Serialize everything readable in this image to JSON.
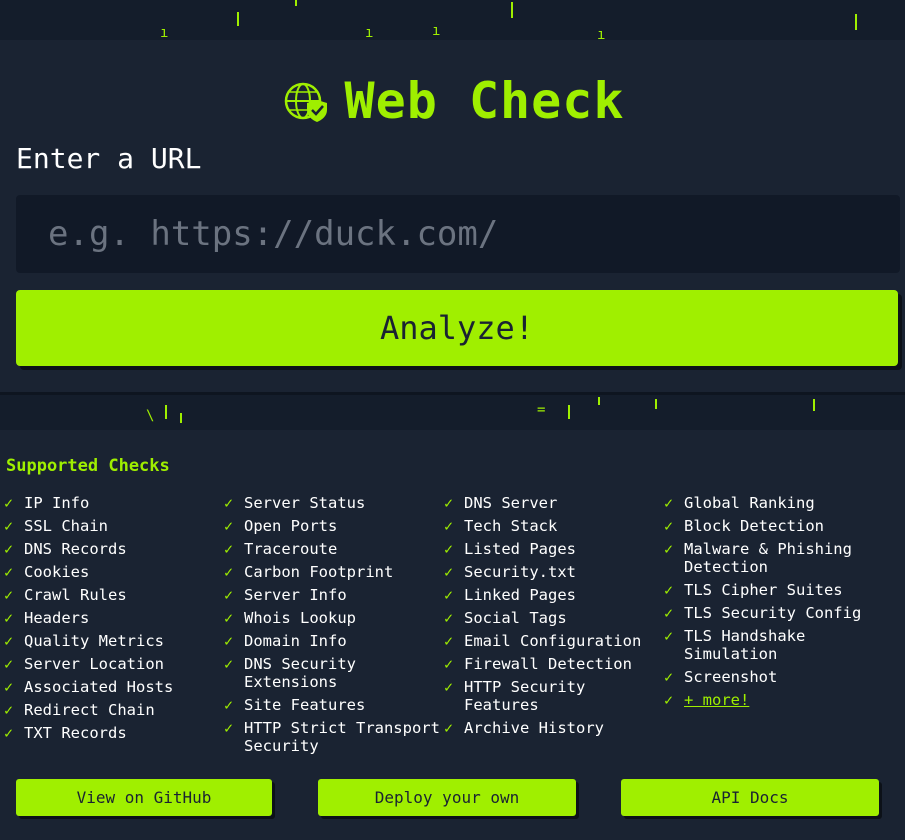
{
  "app": {
    "title": "Web Check",
    "url_label": "Enter a URL",
    "url_placeholder": "e.g. https://duck.com/",
    "url_value": "",
    "analyze_label": "Analyze!"
  },
  "checks": {
    "heading": "Supported Checks",
    "columns": [
      [
        "IP Info",
        "SSL Chain",
        "DNS Records",
        "Cookies",
        "Crawl Rules",
        "Headers",
        "Quality Metrics",
        "Server Location",
        "Associated Hosts",
        "Redirect Chain",
        "TXT Records"
      ],
      [
        "Server Status",
        "Open Ports",
        "Traceroute",
        "Carbon Footprint",
        "Server Info",
        "Whois Lookup",
        "Domain Info",
        "DNS Security Extensions",
        "Site Features",
        "HTTP Strict Transport Security"
      ],
      [
        "DNS Server",
        "Tech Stack",
        "Listed Pages",
        "Security.txt",
        "Linked Pages",
        "Social Tags",
        "Email Configuration",
        "Firewall Detection",
        "HTTP Security Features",
        "Archive History"
      ],
      [
        "Global Ranking",
        "Block Detection",
        "Malware & Phishing Detection",
        "TLS Cipher Suites",
        "TLS Security Config",
        "TLS Handshake Simulation",
        "Screenshot"
      ]
    ],
    "more_label": "+ more!",
    "check_glyph": "✓"
  },
  "actions": {
    "github": "View on GitHub",
    "deploy": "Deploy your own",
    "api_docs": "API Docs"
  },
  "colors": {
    "accent": "#9fef00",
    "background": "#141d2b",
    "panel": "#1a2332"
  },
  "icons": {
    "logo": "globe-shield-icon"
  }
}
